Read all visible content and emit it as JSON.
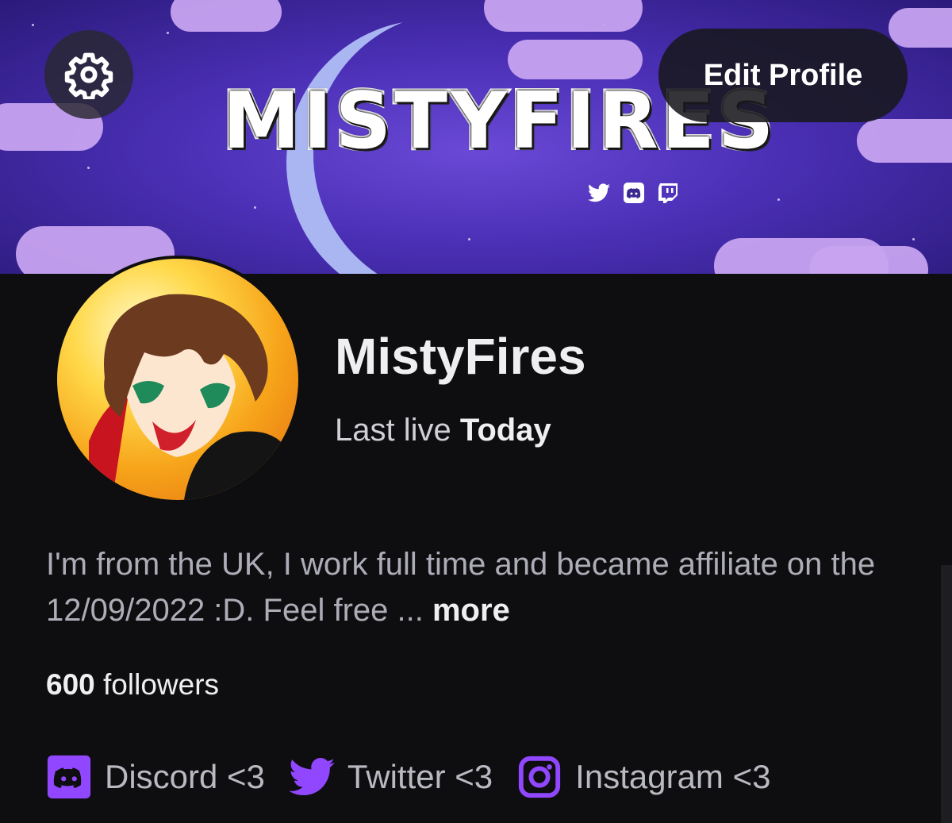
{
  "banner": {
    "title": "MISTYFIRES",
    "socials": [
      "twitter-icon",
      "discord-icon",
      "twitch-icon"
    ],
    "colors": {
      "sky": "#4a2fb5",
      "clouds": "#c7a3f0",
      "moon": "#a9b6f2"
    }
  },
  "header": {
    "settings_icon": "gear-icon",
    "edit_profile_label": "Edit Profile"
  },
  "profile": {
    "channel_name": "MistyFires",
    "last_live_prefix": "Last live ",
    "last_live_value": "Today",
    "bio": "I'm from the UK, I work full time and became affiliate on the 12/09/2022 :D. Feel free ...",
    "bio_more": "more",
    "followers_count": "600",
    "followers_label": "followers"
  },
  "links": [
    {
      "icon": "discord-icon",
      "label": "Discord <3"
    },
    {
      "icon": "twitter-icon",
      "label": "Twitter <3"
    },
    {
      "icon": "instagram-icon",
      "label": "Instagram <3"
    }
  ],
  "colors": {
    "accent": "#9147ff",
    "background": "#0e0e10",
    "text": "#efeff1",
    "muted": "#adadb8"
  }
}
